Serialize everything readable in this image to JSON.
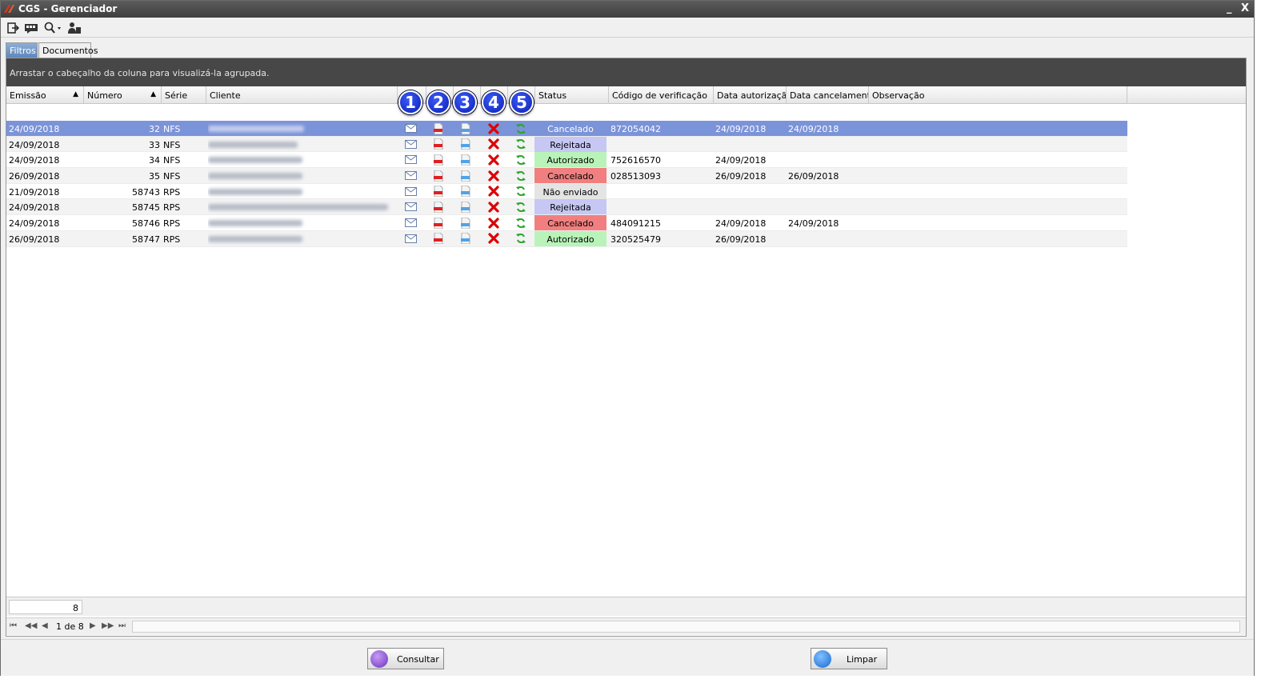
{
  "window": {
    "title": "CGS - Gerenciador",
    "minimize": "_",
    "close": "X"
  },
  "toolbar": {
    "icons": [
      "exit-icon",
      "messages-icon",
      "search-icon",
      "user-icon"
    ]
  },
  "tabs": [
    "Filtros",
    "Documentos"
  ],
  "group_hint": "Arrastar o cabeçalho da coluna para visualizá-la agrupada.",
  "columns": {
    "emissao": "Emissão",
    "numero": "Número",
    "serie": "Série",
    "cliente": "Cliente",
    "status": "Status",
    "codigo": "Código de verificação",
    "data_aut": "Data autorização",
    "data_canc": "Data cancelamento",
    "observacao": "Observação"
  },
  "action_badges": [
    "1",
    "2",
    "3",
    "4",
    "5"
  ],
  "action_icons": [
    "email-icon",
    "pdf-icon",
    "xml-icon",
    "cancel-icon",
    "refresh-icon"
  ],
  "rows": [
    {
      "emissao": "24/09/2018",
      "numero": "32",
      "serie": "NFS",
      "status": "Cancelado",
      "status_type": "cancel",
      "codigo": "872054042",
      "data_aut": "24/09/2018",
      "data_canc": "24/09/2018"
    },
    {
      "emissao": "24/09/2018",
      "numero": "33",
      "serie": "NFS",
      "status": "Rejeitada",
      "status_type": "rej",
      "codigo": "",
      "data_aut": "",
      "data_canc": ""
    },
    {
      "emissao": "24/09/2018",
      "numero": "34",
      "serie": "NFS",
      "status": "Autorizado",
      "status_type": "aut",
      "codigo": "752616570",
      "data_aut": "24/09/2018",
      "data_canc": ""
    },
    {
      "emissao": "26/09/2018",
      "numero": "35",
      "serie": "NFS",
      "status": "Cancelado",
      "status_type": "cancel",
      "codigo": "028513093",
      "data_aut": "26/09/2018",
      "data_canc": "26/09/2018"
    },
    {
      "emissao": "21/09/2018",
      "numero": "58743",
      "serie": "RPS",
      "status": "Não enviado",
      "status_type": "nao",
      "codigo": "",
      "data_aut": "",
      "data_canc": ""
    },
    {
      "emissao": "24/09/2018",
      "numero": "58745",
      "serie": "RPS",
      "status": "Rejeitada",
      "status_type": "rej",
      "codigo": "",
      "data_aut": "",
      "data_canc": ""
    },
    {
      "emissao": "24/09/2018",
      "numero": "58746",
      "serie": "RPS",
      "status": "Cancelado",
      "status_type": "cancel",
      "codigo": "484091215",
      "data_aut": "24/09/2018",
      "data_canc": "24/09/2018"
    },
    {
      "emissao": "26/09/2018",
      "numero": "58747",
      "serie": "RPS",
      "status": "Autorizado",
      "status_type": "aut",
      "codigo": "320525479",
      "data_aut": "26/09/2018",
      "data_canc": ""
    }
  ],
  "footer": {
    "count": "8"
  },
  "pager": {
    "text": "1 de 8"
  },
  "buttons": {
    "consultar": "Consultar",
    "limpar": "Limpar"
  },
  "colors": {
    "selected_row": "#7b93d8",
    "cancelado": "#f17f7f",
    "rejeitada": "#c7c7f4",
    "autorizado": "#b9f3b9",
    "nao_enviado": "#e4e4e4",
    "badge": "#0a1fb8"
  }
}
